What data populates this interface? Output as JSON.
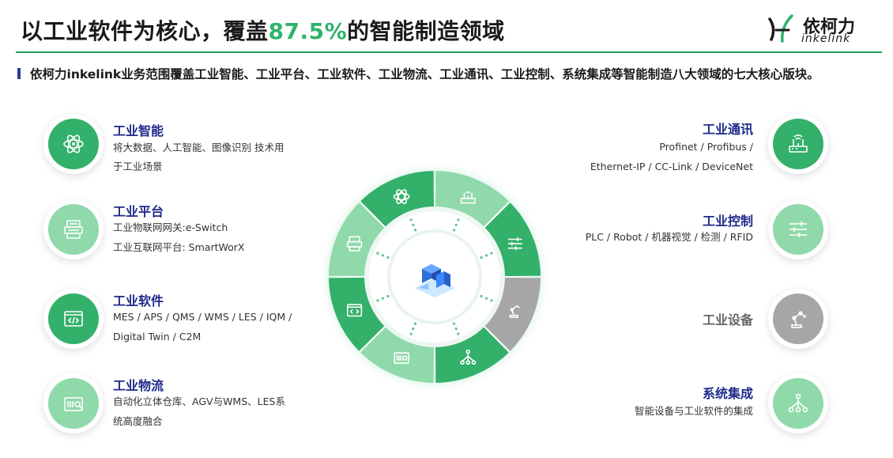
{
  "header": {
    "title_prefix": "以工业软件为核心，覆盖",
    "title_highlight": "87.5%",
    "title_suffix": "的智能制造领域",
    "logo_cn": "依柯力",
    "logo_en": "inkelink"
  },
  "subtitle": "依柯力inkelink业务范围覆盖工业智能、工业平台、工业软件、工业物流、工业通讯、工业控制、系统集成等智能制造八大领域的七大核心版块。",
  "left": [
    {
      "title": "工业智能",
      "lines": [
        "将大数据、人工智能、图像识别 技术用",
        "于工业场景"
      ],
      "icon": "atom-icon",
      "tone": "dark"
    },
    {
      "title": "工业平台",
      "lines": [
        "工业物联网网关:e-Switch",
        "工业互联网平台: SmartWorX"
      ],
      "icon": "server-icon",
      "tone": "light"
    },
    {
      "title": "工业软件",
      "lines": [
        "MES / APS / QMS / WMS / LES / IQM /",
        "Digital Twin / C2M"
      ],
      "icon": "code-window-icon",
      "tone": "dark"
    },
    {
      "title": "工业物流",
      "lines": [
        "自动化立体仓库、AGV与WMS、LES系",
        "统高度融合"
      ],
      "icon": "scan-box-icon",
      "tone": "light"
    }
  ],
  "right": [
    {
      "title": "工业通讯",
      "lines": [
        "Profinet / Profibus /",
        "Ethernet-IP / CC-Link / DeviceNet"
      ],
      "icon": "router-icon",
      "tone": "dark"
    },
    {
      "title": "工业控制",
      "lines": [
        "PLC / Robot / 机器视觉 / 检测 / RFID"
      ],
      "icon": "sliders-icon",
      "tone": "light"
    },
    {
      "title": "工业设备",
      "lines": [],
      "icon": "robot-arm-icon",
      "tone": "gray"
    },
    {
      "title": "系统集成",
      "lines": [
        "智能设备与工业软件的集成"
      ],
      "icon": "network-tree-icon",
      "tone": "light"
    }
  ],
  "colors": {
    "dark_green": "#33b06a",
    "light_green": "#8fd9ab",
    "gray": "#a6a6a6",
    "title_blue": "#1e2a8a",
    "accent": "#2fb36b"
  }
}
